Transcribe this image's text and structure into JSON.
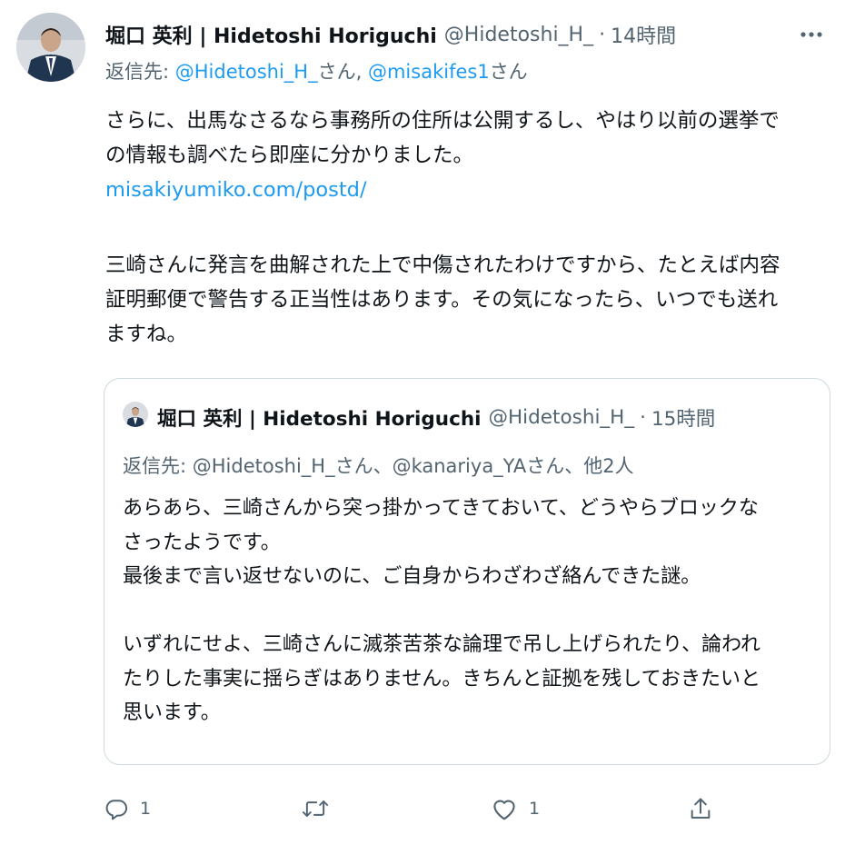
{
  "tweet": {
    "author": {
      "display_name": "堀口 英利 | Hidetoshi Horiguchi",
      "handle": "@Hidetoshi_H_",
      "avatar_icon": "profile-photo"
    },
    "separator": "·",
    "time": "14時間",
    "more_icon": "more-horizontal-icon",
    "replying": {
      "prefix": "返信先: ",
      "mention1": "@Hidetoshi_H_",
      "suffix1": "さん, ",
      "mention2": "@misakifes1",
      "suffix2": "さん"
    },
    "text": {
      "line1": "さらに、出馬なさるなら事務所の住所は公開するし、やはり以前の選挙で",
      "line2": "の情報も調べたら即座に分かりました。",
      "link": "misakiyumiko.com/postd/",
      "line4": "三崎さんに発言を曲解された上で中傷されたわけですから、たとえば内容",
      "line5": "証明郵便で警告する正当性はあります。その気になったら、いつでも送れ",
      "line6": "ますね。"
    }
  },
  "quoted_tweet": {
    "author": {
      "display_name": "堀口 英利 | Hidetoshi Horiguchi",
      "handle": "@Hidetoshi_H_"
    },
    "separator": "·",
    "time": "15時間",
    "replying": "返信先: @Hidetoshi_H_さん、@kanariya_YAさん、他2人",
    "text": {
      "line1": "あらあら、三崎さんから突っ掛かってきておいて、どうやらブロックな",
      "line2": "さったようです。",
      "line3": "最後まで言い返せないのに、ご自身からわざわざ絡んできた謎。",
      "line5": "いずれにせよ、三崎さんに滅茶苦茶な論理で吊し上げられたり、論われ",
      "line6": "たりした事実に揺らぎはありません。きちんと証拠を残しておきたいと",
      "line7": "思います。"
    }
  },
  "actions": {
    "reply": {
      "icon": "reply-icon",
      "count": "1"
    },
    "retweet": {
      "icon": "retweet-icon"
    },
    "like": {
      "icon": "heart-icon",
      "count": "1"
    },
    "share": {
      "icon": "share-icon"
    }
  },
  "colors": {
    "link": "#1d9bf0",
    "secondary_text": "#536471",
    "border": "#cfd9de",
    "primary_text": "#0f1419"
  }
}
